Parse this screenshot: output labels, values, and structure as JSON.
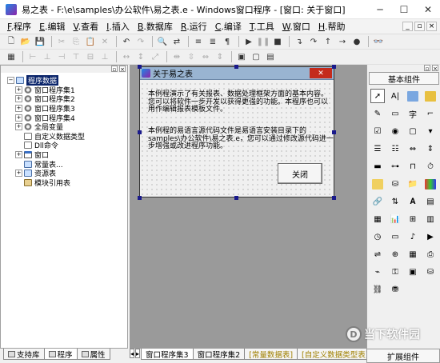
{
  "window": {
    "title": "易之表 - F:\\e\\samples\\办公软件\\易之表.e - Windows窗口程序 - [窗口: 关于窗口]"
  },
  "menu": [
    {
      "key": "F",
      "label": ".程序"
    },
    {
      "key": "E",
      "label": ".编辑"
    },
    {
      "key": "V",
      "label": ".查看"
    },
    {
      "key": "I",
      "label": ".插入"
    },
    {
      "key": "B",
      "label": ".数据库"
    },
    {
      "key": "R",
      "label": ".运行"
    },
    {
      "key": "C",
      "label": ".编译"
    },
    {
      "key": "T",
      "label": ".工具"
    },
    {
      "key": "W",
      "label": ".窗口"
    },
    {
      "key": "H",
      "label": ".帮助"
    }
  ],
  "tree": {
    "root": "程序数据",
    "items": [
      {
        "label": "窗口程序集1",
        "icon": "gear",
        "expand": "+"
      },
      {
        "label": "窗口程序集2",
        "icon": "gear",
        "expand": "+"
      },
      {
        "label": "窗口程序集3",
        "icon": "gear",
        "expand": "+"
      },
      {
        "label": "窗口程序集4",
        "icon": "gear",
        "expand": "+"
      },
      {
        "label": "全局变量",
        "icon": "gear",
        "expand": "+"
      },
      {
        "label": "自定义数据类型",
        "icon": "doc",
        "expand": ""
      },
      {
        "label": "Dll命令",
        "icon": "doc",
        "expand": ""
      },
      {
        "label": "窗口",
        "icon": "win",
        "expand": "+"
      },
      {
        "label": "常量表...",
        "icon": "box",
        "expand": ""
      },
      {
        "label": "资源表",
        "icon": "box",
        "expand": "+"
      },
      {
        "label": "模块引用表",
        "icon": "tree",
        "expand": ""
      }
    ]
  },
  "left_tabs": [
    "支持库",
    "程序",
    "属性"
  ],
  "designer": {
    "title": "关于易之表",
    "para1": "本例程演示了有关报表、数据处理框架方面的基本内容。您可以将软件一步开发以获得更强的功能。本程序也可以用作编辑报表模板文件。",
    "para2": "本例程的易语言源代码文件是易语言安装目录下的samples\\办公软件\\易之表.e，您可以通过修改源代码进一步增强或改进程序功能。",
    "close_label": "关闭"
  },
  "right_panel": {
    "basic_tab": "基本组件",
    "expand_tab": "扩展组件"
  },
  "bottom_tabs": [
    {
      "label": "窗口程序集3",
      "style": "normal"
    },
    {
      "label": "窗口程序集2",
      "style": "normal"
    },
    {
      "label": "[常量数据表]",
      "style": "yellow"
    },
    {
      "label": "[自定义数据类型表]",
      "style": "yellow"
    }
  ],
  "watermark": {
    "logo": "D",
    "text": "当下软件园"
  }
}
